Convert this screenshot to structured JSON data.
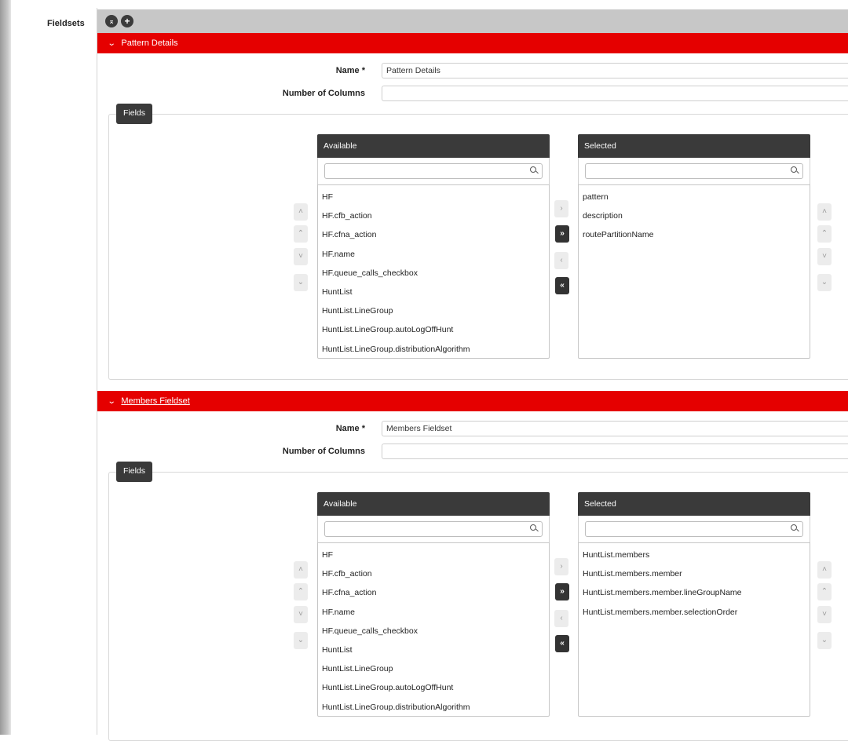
{
  "page": {
    "fieldsets_label": "Fieldsets",
    "collapse_all_symbol": "⌅",
    "add_symbol": "+"
  },
  "fieldsets": [
    {
      "title": "Pattern Details",
      "title_is_link": false,
      "name_label": "Name *",
      "name_value": "Pattern Details",
      "columns_label": "Number of Columns",
      "columns_value": "",
      "fields_tab": "Fields",
      "available": {
        "header": "Available",
        "search_value": "",
        "items": [
          "HF",
          "HF.cfb_action",
          "HF.cfna_action",
          "HF.name",
          "HF.queue_calls_checkbox",
          "HuntList",
          "HuntList.LineGroup",
          "HuntList.LineGroup.autoLogOffHunt",
          "HuntList.LineGroup.distributionAlgorithm"
        ]
      },
      "selected": {
        "header": "Selected",
        "search_value": "",
        "items": [
          "pattern",
          "description",
          "routePartitionName"
        ]
      }
    },
    {
      "title": "Members Fieldset",
      "title_is_link": true,
      "name_label": "Name *",
      "name_value": "Members Fieldset",
      "columns_label": "Number of Columns",
      "columns_value": "",
      "fields_tab": "Fields",
      "available": {
        "header": "Available",
        "search_value": "",
        "items": [
          "HF",
          "HF.cfb_action",
          "HF.cfna_action",
          "HF.name",
          "HF.queue_calls_checkbox",
          "HuntList",
          "HuntList.LineGroup",
          "HuntList.LineGroup.autoLogOffHunt",
          "HuntList.LineGroup.distributionAlgorithm"
        ]
      },
      "selected": {
        "header": "Selected",
        "search_value": "",
        "items": [
          "HuntList.members",
          "HuntList.members.member",
          "HuntList.members.member.lineGroupName",
          "HuntList.members.member.selectionOrder"
        ]
      }
    }
  ],
  "controls": {
    "move_up": "˄",
    "move_top": "⌃",
    "move_down": "˅",
    "move_bottom": "⌄",
    "add_one": "›",
    "add_all": "»",
    "remove_one": "‹",
    "remove_all": "«"
  },
  "icons": {
    "collapse_all": "collapse-all-icon",
    "add": "plus-icon",
    "expand_chevron": "chevron-down-icon",
    "search": "search-icon"
  },
  "colors": {
    "header_red": "#e50000",
    "dark": "#3a3a3a",
    "toolbar_grey": "#c7c7c7"
  }
}
